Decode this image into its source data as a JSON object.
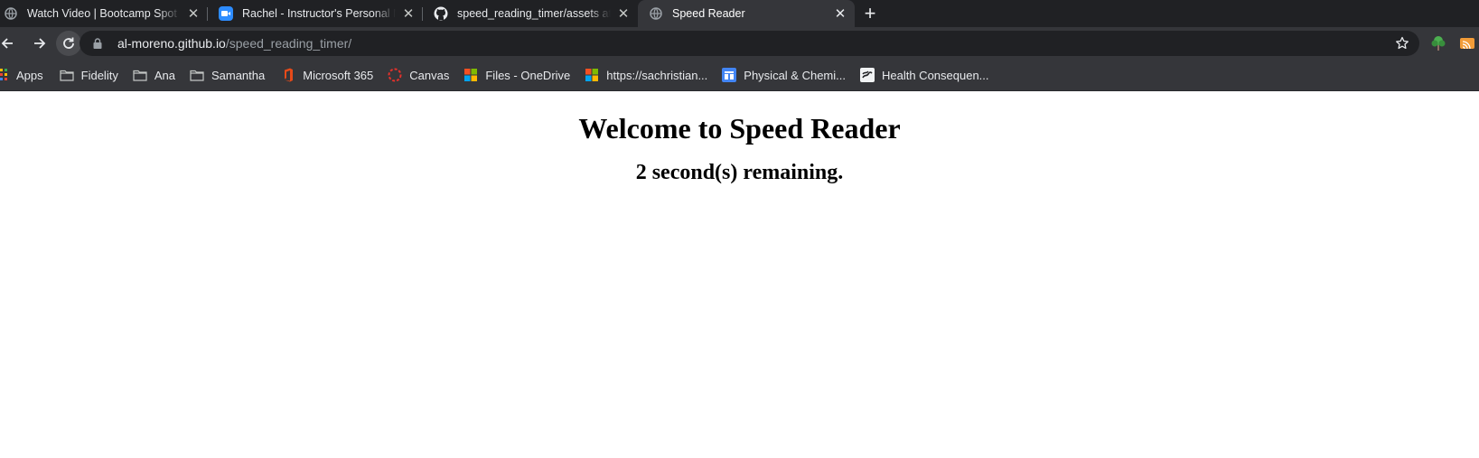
{
  "tabs": [
    {
      "title": "Watch Video | Bootcamp Spot",
      "icon": "globe-icon",
      "active": false
    },
    {
      "title": "Rachel - Instructor's Personal Meeting Room",
      "icon": "zoom-icon",
      "active": false
    },
    {
      "title": "speed_reading_timer/assets at main",
      "icon": "github-icon",
      "active": false
    },
    {
      "title": "Speed Reader",
      "icon": "globe-icon",
      "active": true
    }
  ],
  "address_bar": {
    "host": "al-moreno.github.io",
    "path": "/speed_reading_timer/"
  },
  "bookmarks": [
    {
      "label": "Apps",
      "icon": "apps-grid-icon"
    },
    {
      "label": "Fidelity",
      "icon": "folder-icon"
    },
    {
      "label": "Ana",
      "icon": "folder-icon"
    },
    {
      "label": "Samantha",
      "icon": "folder-icon"
    },
    {
      "label": "Microsoft 365",
      "icon": "office-icon"
    },
    {
      "label": "Canvas",
      "icon": "canvas-icon"
    },
    {
      "label": "Files - OneDrive",
      "icon": "microsoft-icon"
    },
    {
      "label": "https://sachristian...",
      "icon": "microsoft-icon"
    },
    {
      "label": "Physical & Chemi...",
      "icon": "document-icon"
    },
    {
      "label": "Health Consequen...",
      "icon": "image-icon"
    }
  ],
  "page": {
    "heading": "Welcome to Speed Reader",
    "timer_text": "2 second(s) remaining."
  },
  "colors": {
    "tabstrip_bg": "#202124",
    "toolbar_bg": "#35363a",
    "omnibox_bg": "#202124",
    "page_bg": "#ffffff"
  }
}
